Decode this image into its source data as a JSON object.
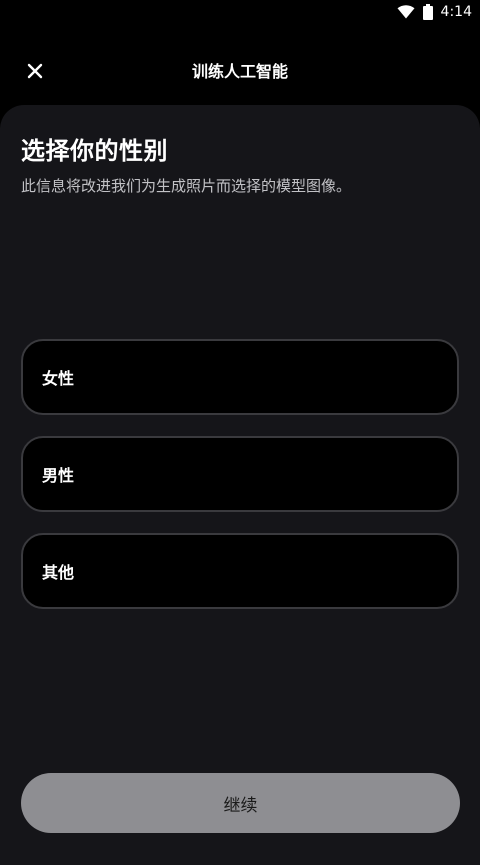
{
  "status_bar": {
    "time": "4:14",
    "icons": [
      "wifi-icon",
      "battery-icon"
    ]
  },
  "header": {
    "title": "训练人工智能",
    "close_icon": "close-icon"
  },
  "sheet": {
    "title": "选择你的性别",
    "subtitle": "此信息将改进我们为生成照片而选择的模型图像。",
    "options": [
      {
        "label": "女性"
      },
      {
        "label": "男性"
      },
      {
        "label": "其他"
      }
    ],
    "continue_label": "继续"
  },
  "colors": {
    "background": "#000000",
    "sheet": "#151519",
    "option_border": "#3a3a3e",
    "button": "#8e8e92",
    "subtitle_text": "#c2c2c6"
  }
}
